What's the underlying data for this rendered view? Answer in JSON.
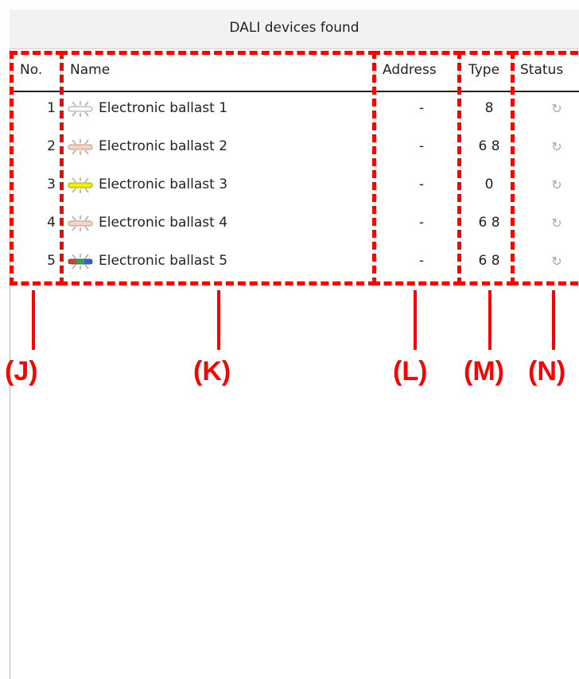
{
  "panel": {
    "title": "DALI devices found"
  },
  "columns": {
    "no": "No.",
    "name": "Name",
    "address": "Address",
    "type": "Type",
    "status": "Status"
  },
  "rows": [
    {
      "no": "1",
      "name": "Electronic ballast 1",
      "address": "-",
      "type": "8",
      "status": "↻",
      "icon": "ballast-white-icon"
    },
    {
      "no": "2",
      "name": "Electronic ballast 2",
      "address": "-",
      "type": "6 8",
      "status": "↻",
      "icon": "ballast-peach-icon"
    },
    {
      "no": "3",
      "name": "Electronic ballast 3",
      "address": "-",
      "type": "0",
      "status": "↻",
      "icon": "ballast-yellow-icon"
    },
    {
      "no": "4",
      "name": "Electronic ballast 4",
      "address": "-",
      "type": "6 8",
      "status": "↻",
      "icon": "ballast-peach-icon"
    },
    {
      "no": "5",
      "name": "Electronic ballast 5",
      "address": "-",
      "type": "6 8",
      "status": "↻",
      "icon": "ballast-rgb-icon"
    }
  ],
  "callouts": {
    "j": "(J)",
    "k": "(K)",
    "l": "(L)",
    "m": "(M)",
    "n": "(N)"
  },
  "colors": {
    "annotation": "#ff0000",
    "header_rule": "#222222",
    "status_icon": "#a8a8a8"
  }
}
